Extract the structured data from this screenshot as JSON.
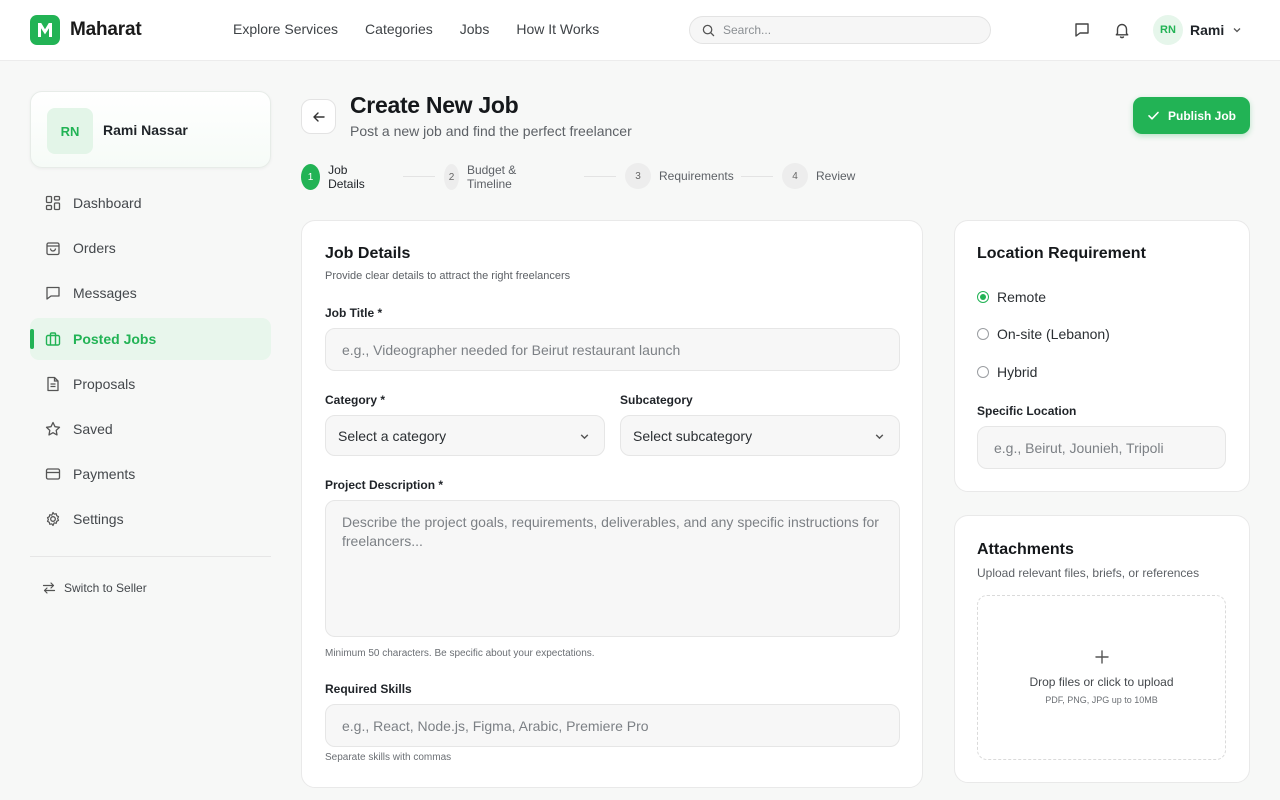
{
  "brand": {
    "name": "Maharat",
    "logo_letter": "M",
    "accent": "#22b355"
  },
  "nav": {
    "links": [
      "Explore Services",
      "Categories",
      "Jobs",
      "How It Works"
    ],
    "search_placeholder": "Search..."
  },
  "user": {
    "initials": "RN",
    "short_name": "Rami",
    "full_name": "Rami Nassar"
  },
  "sidebar": {
    "items": [
      {
        "label": "Dashboard",
        "icon": "dashboard-icon",
        "active": false
      },
      {
        "label": "Orders",
        "icon": "shopping-bag-icon",
        "active": false
      },
      {
        "label": "Messages",
        "icon": "message-icon",
        "active": false
      },
      {
        "label": "Posted Jobs",
        "icon": "briefcase-icon",
        "active": true
      },
      {
        "label": "Proposals",
        "icon": "document-icon",
        "active": false
      },
      {
        "label": "Saved",
        "icon": "star-icon",
        "active": false
      },
      {
        "label": "Payments",
        "icon": "credit-card-icon",
        "active": false
      },
      {
        "label": "Settings",
        "icon": "gear-icon",
        "active": false
      }
    ],
    "switch_label": "Switch to Seller"
  },
  "header": {
    "title": "Create New Job",
    "subtitle": "Post a new job and find the perfect freelancer",
    "publish_label": "Publish Job"
  },
  "steps": [
    {
      "num": "1",
      "label": "Job Details",
      "active": true
    },
    {
      "num": "2",
      "label": "Budget & Timeline",
      "active": false
    },
    {
      "num": "3",
      "label": "Requirements",
      "active": false
    },
    {
      "num": "4",
      "label": "Review",
      "active": false
    }
  ],
  "job_details": {
    "title": "Job Details",
    "subtitle": "Provide clear details to attract the right freelancers",
    "job_title_label": "Job Title *",
    "job_title_placeholder": "e.g., Videographer needed for Beirut restaurant launch",
    "category_label": "Category *",
    "category_value": "Select a category",
    "subcategory_label": "Subcategory",
    "subcategory_value": "Select subcategory",
    "description_label": "Project Description *",
    "description_placeholder": "Describe the project goals, requirements, deliverables, and any specific instructions for freelancers...",
    "description_hint": "Minimum 50 characters. Be specific about your expectations.",
    "skills_label": "Required Skills",
    "skills_placeholder": "e.g., React, Node.js, Figma, Arabic, Premiere Pro",
    "skills_hint": "Separate skills with commas"
  },
  "location": {
    "title": "Location Requirement",
    "options": [
      {
        "label": "Remote",
        "checked": true
      },
      {
        "label": "On-site (Lebanon)",
        "checked": false
      },
      {
        "label": "Hybrid",
        "checked": false
      }
    ],
    "specific_label": "Specific Location",
    "specific_placeholder": "e.g., Beirut, Jounieh, Tripoli"
  },
  "attachments": {
    "title": "Attachments",
    "subtitle": "Upload relevant files, briefs, or references",
    "drop_text": "Drop files or click to upload",
    "drop_hint": "PDF, PNG, JPG up to 10MB"
  }
}
